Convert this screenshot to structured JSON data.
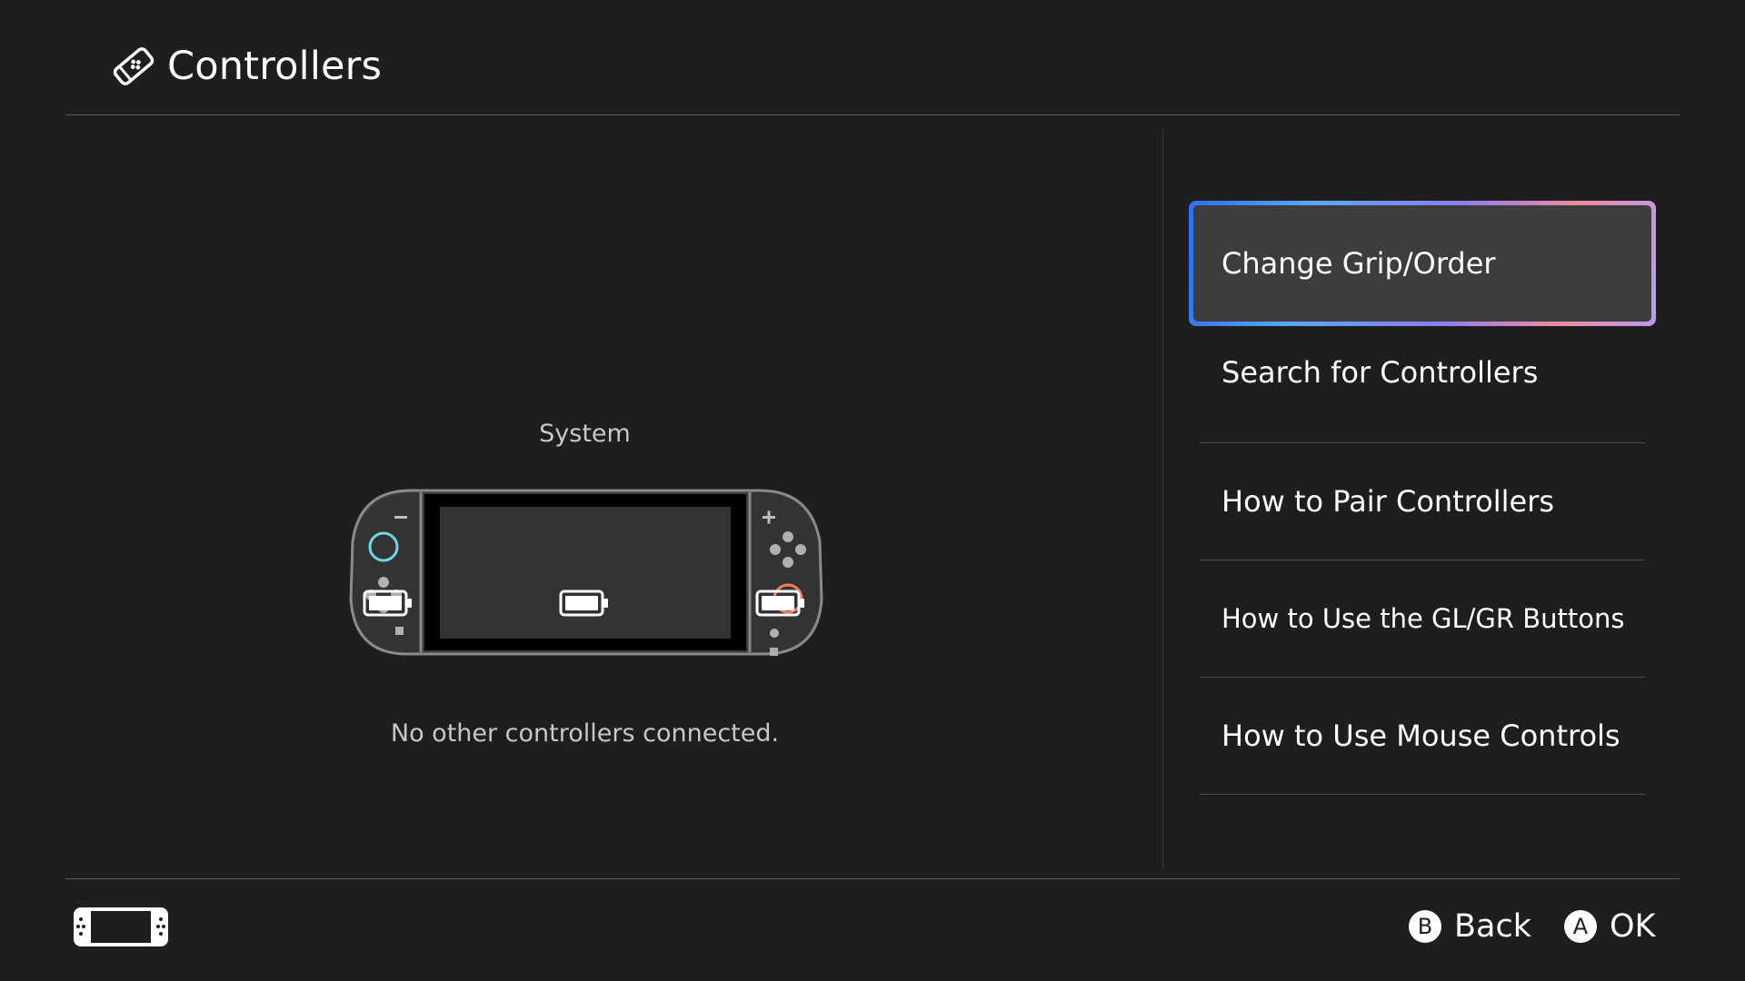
{
  "header": {
    "title": "Controllers",
    "icon": "controller-icon"
  },
  "system": {
    "label": "System",
    "status": "No other controllers connected.",
    "left_stick_color": "#6fd6e4",
    "right_stick_color": "#f0805a"
  },
  "menu": {
    "items": [
      {
        "label": "Change Grip/Order",
        "selected": true
      },
      {
        "label": "Search for Controllers"
      },
      {
        "label": "How to Pair Controllers"
      },
      {
        "label": "How to Use the GL/GR Buttons"
      },
      {
        "label": "How to Use Mouse Controls"
      }
    ]
  },
  "footer": {
    "back": {
      "glyph": "B",
      "label": "Back"
    },
    "ok": {
      "glyph": "A",
      "label": "OK"
    }
  },
  "colors": {
    "background": "#1e1e1e",
    "selected_bg": "#3d3d3d",
    "text": "#ffffff",
    "muted_text": "#c8c8c8"
  }
}
